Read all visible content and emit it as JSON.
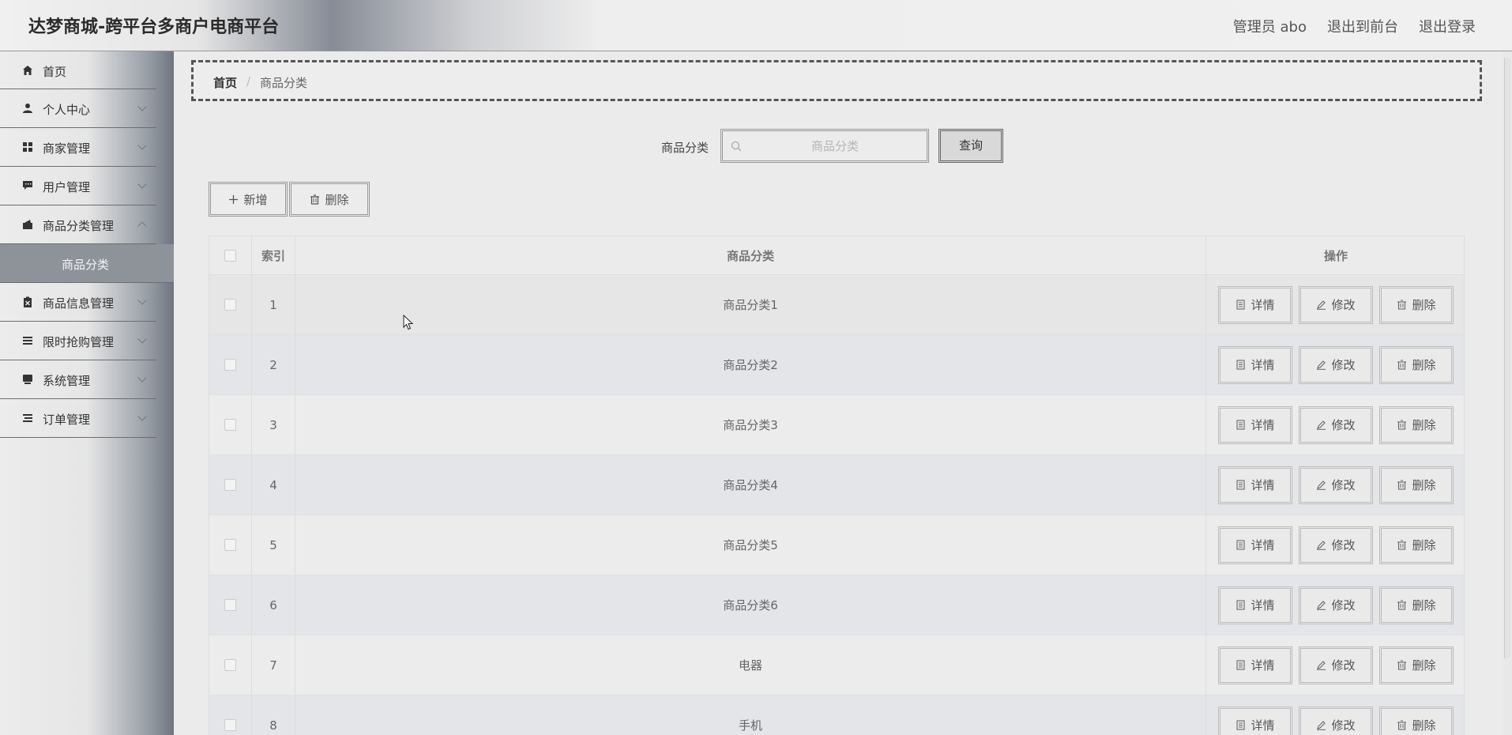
{
  "header": {
    "title": "达梦商城-跨平台多商户电商平台",
    "admin_label": "管理员 abo",
    "to_front": "退出到前台",
    "logout": "退出登录"
  },
  "sidebar": {
    "items": [
      {
        "label": "首页",
        "icon": "home-icon"
      },
      {
        "label": "个人中心",
        "icon": "user-icon"
      },
      {
        "label": "商家管理",
        "icon": "grid-icon"
      },
      {
        "label": "用户管理",
        "icon": "chat-icon"
      },
      {
        "label": "商品分类管理",
        "icon": "wallet-icon"
      },
      {
        "label": "商品信息管理",
        "icon": "clipboard-icon"
      },
      {
        "label": "限时抢购管理",
        "icon": "list-icon"
      },
      {
        "label": "系统管理",
        "icon": "monitor-icon"
      },
      {
        "label": "订单管理",
        "icon": "list-icon"
      }
    ],
    "active_sub": "商品分类"
  },
  "breadcrumb": {
    "home": "首页",
    "sep": "/",
    "current": "商品分类"
  },
  "search": {
    "label": "商品分类",
    "placeholder": "商品分类",
    "button": "查询"
  },
  "actions": {
    "add": "新增",
    "delete": "删除"
  },
  "table": {
    "headers": {
      "index": "索引",
      "name": "商品分类",
      "ops": "操作"
    },
    "rows": [
      {
        "index": "1",
        "name": "商品分类1"
      },
      {
        "index": "2",
        "name": "商品分类2"
      },
      {
        "index": "3",
        "name": "商品分类3"
      },
      {
        "index": "4",
        "name": "商品分类4"
      },
      {
        "index": "5",
        "name": "商品分类5"
      },
      {
        "index": "6",
        "name": "商品分类6"
      },
      {
        "index": "7",
        "name": "电器"
      },
      {
        "index": "8",
        "name": "手机"
      }
    ],
    "op_labels": {
      "detail": "详情",
      "edit": "修改",
      "delete": "删除"
    }
  }
}
